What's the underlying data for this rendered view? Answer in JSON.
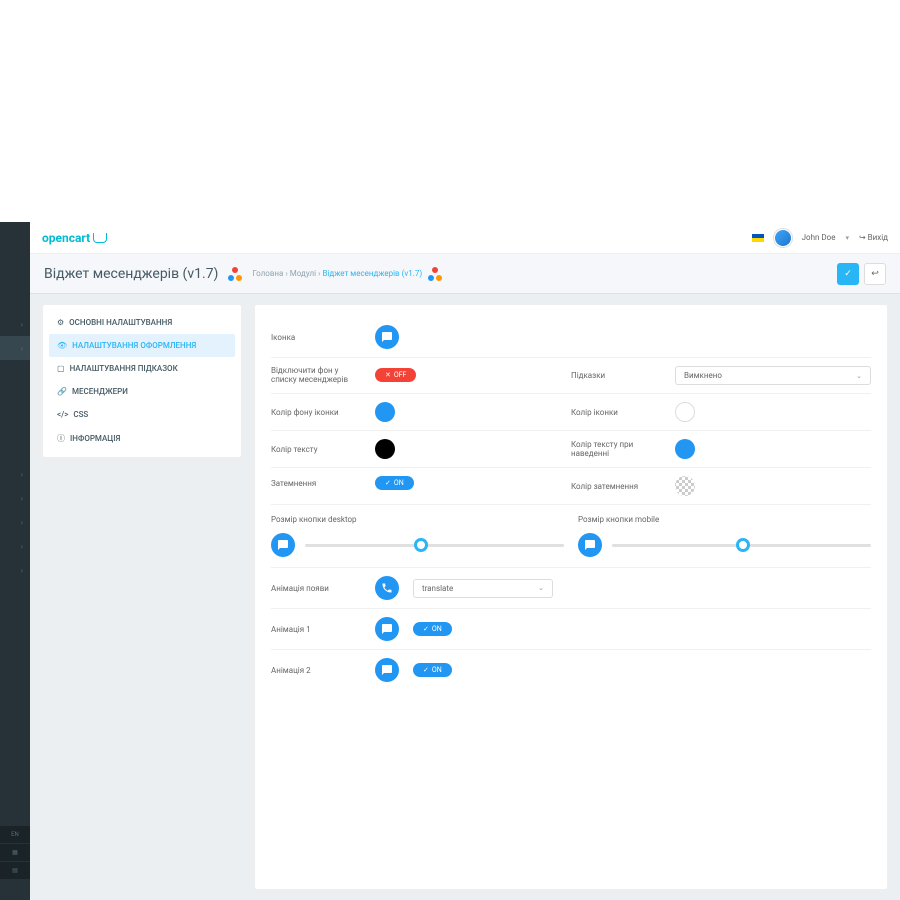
{
  "brand": "opencart",
  "user": {
    "name": "John Doe",
    "logout": "Вихід"
  },
  "header": {
    "title": "Віджет месенджерів (v1.7)",
    "breadcrumb": {
      "home": "Головна",
      "modules": "Модулі",
      "current": "Віджет месенджерів (v1.7)"
    }
  },
  "tabs": [
    {
      "icon": "gear",
      "label": "ОСНОВНІ НАЛАШТУВАННЯ"
    },
    {
      "icon": "eye",
      "label": "НАЛАШТУВАННЯ ОФОРМЛЕННЯ",
      "active": true
    },
    {
      "icon": "square",
      "label": "НАЛАШТУВАННЯ ПІДКАЗОК"
    },
    {
      "icon": "link",
      "label": "МЕСЕНДЖЕРИ"
    },
    {
      "icon": "code",
      "label": "CSS"
    },
    {
      "icon": "info",
      "label": "ІНФОРМАЦІЯ"
    }
  ],
  "settings": {
    "icon_label": "Іконка",
    "disable_bg_label": "Відключити фон у списку месенджерів",
    "disable_bg_value": "OFF",
    "hints_label": "Підказки",
    "hints_value": "Вимкнено",
    "bg_color_label": "Колір фону іконки",
    "icon_color_label": "Колір іконки",
    "text_color_label": "Колір тексту",
    "hover_text_color_label": "Колір тексту при наведенні",
    "dimming_label": "Затемнення",
    "dimming_value": "ON",
    "dimming_color_label": "Колір затемнення",
    "size_desktop_label": "Розмір кнопки desktop",
    "size_mobile_label": "Розмір кнопки mobile",
    "appear_anim_label": "Анімація появи",
    "appear_anim_value": "translate",
    "anim1_label": "Анімація 1",
    "anim1_value": "ON",
    "anim2_label": "Анімація 2",
    "anim2_value": "ON"
  },
  "colors": {
    "bg_color": "#2196f3",
    "icon_color": "#ffffff",
    "text_color": "#000000",
    "hover_text_color": "#2196f3"
  }
}
